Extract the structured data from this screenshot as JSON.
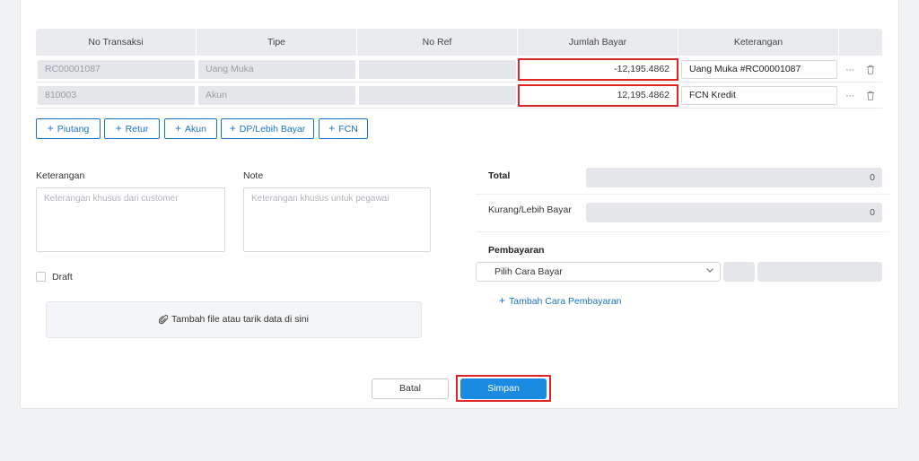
{
  "table": {
    "headers": [
      "No Transaksi",
      "Tipe",
      "No Ref",
      "Jumlah Bayar",
      "Keterangan"
    ],
    "rows": [
      {
        "no_transaksi": "RC00001087",
        "tipe": "Uang Muka",
        "no_ref": "",
        "jumlah_bayar": "-12,195.4862",
        "keterangan": "Uang Muka #RC00001087"
      },
      {
        "no_transaksi": "810003",
        "tipe": "Akun",
        "no_ref": "",
        "jumlah_bayar": "12,195.4862",
        "keterangan": "FCN Kredit"
      }
    ],
    "more_icon": "ellipsis-icon",
    "delete_icon": "trash-icon"
  },
  "add_buttons": [
    "Piutang",
    "Retur",
    "Akun",
    "DP/Lebih Bayar",
    "FCN"
  ],
  "form": {
    "keterangan_label": "Keterangan",
    "keterangan_placeholder": "Keterangan khusus dari customer",
    "note_label": "Note",
    "note_placeholder": "Keterangan khusus untuk pegawai",
    "draft_label": "Draft",
    "upload_label": "Tambah file atau tarik data di sini",
    "upload_icon": "paperclip-icon"
  },
  "summary": {
    "total_label": "Total",
    "total_value": "0",
    "kurang_label": "Kurang/Lebih Bayar",
    "kurang_value": "0",
    "pembayaran_label": "Pembayaran",
    "cara_bayar_placeholder": "Pilih Cara Bayar",
    "add_payment_label": "Tambah Cara Pembayaran"
  },
  "actions": {
    "cancel_label": "Batal",
    "save_label": "Simpan"
  },
  "colors": {
    "accent": "#1a73c8",
    "primary_button": "#1a8be0",
    "highlight_border": "#e02424"
  }
}
